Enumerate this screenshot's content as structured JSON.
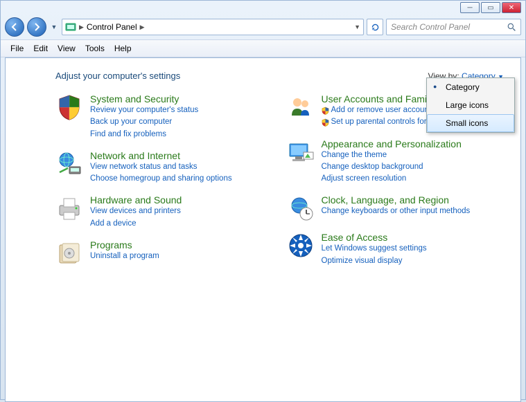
{
  "window": {
    "title": "Control Panel"
  },
  "nav": {
    "breadcrumb": [
      "Control Panel"
    ],
    "search_placeholder": "Search Control Panel"
  },
  "menu": {
    "items": [
      "File",
      "Edit",
      "View",
      "Tools",
      "Help"
    ]
  },
  "header": {
    "heading": "Adjust your computer's settings",
    "viewby_label": "View by:",
    "viewby_value": "Category"
  },
  "viewby_options": [
    "Category",
    "Large icons",
    "Small icons"
  ],
  "viewby_selected": "Category",
  "viewby_hover": "Small icons",
  "categories_left": [
    {
      "title": "System and Security",
      "links": [
        {
          "text": "Review your computer's status",
          "shield": false
        },
        {
          "text": "Back up your computer",
          "shield": false
        },
        {
          "text": "Find and fix problems",
          "shield": false
        }
      ],
      "icon": "shield"
    },
    {
      "title": "Network and Internet",
      "links": [
        {
          "text": "View network status and tasks",
          "shield": false
        },
        {
          "text": "Choose homegroup and sharing options",
          "shield": false
        }
      ],
      "icon": "network"
    },
    {
      "title": "Hardware and Sound",
      "links": [
        {
          "text": "View devices and printers",
          "shield": false
        },
        {
          "text": "Add a device",
          "shield": false
        }
      ],
      "icon": "printer"
    },
    {
      "title": "Programs",
      "links": [
        {
          "text": "Uninstall a program",
          "shield": false
        }
      ],
      "icon": "programs"
    }
  ],
  "categories_right": [
    {
      "title": "User Accounts and Family Safety",
      "links": [
        {
          "text": "Add or remove user accounts",
          "shield": true
        },
        {
          "text": "Set up parental controls for any user",
          "shield": true
        }
      ],
      "icon": "users"
    },
    {
      "title": "Appearance and Personalization",
      "links": [
        {
          "text": "Change the theme",
          "shield": false
        },
        {
          "text": "Change desktop background",
          "shield": false
        },
        {
          "text": "Adjust screen resolution",
          "shield": false
        }
      ],
      "icon": "appearance"
    },
    {
      "title": "Clock, Language, and Region",
      "links": [
        {
          "text": "Change keyboards or other input methods",
          "shield": false
        }
      ],
      "icon": "clock"
    },
    {
      "title": "Ease of Access",
      "links": [
        {
          "text": "Let Windows suggest settings",
          "shield": false
        },
        {
          "text": "Optimize visual display",
          "shield": false
        }
      ],
      "icon": "ease"
    }
  ]
}
